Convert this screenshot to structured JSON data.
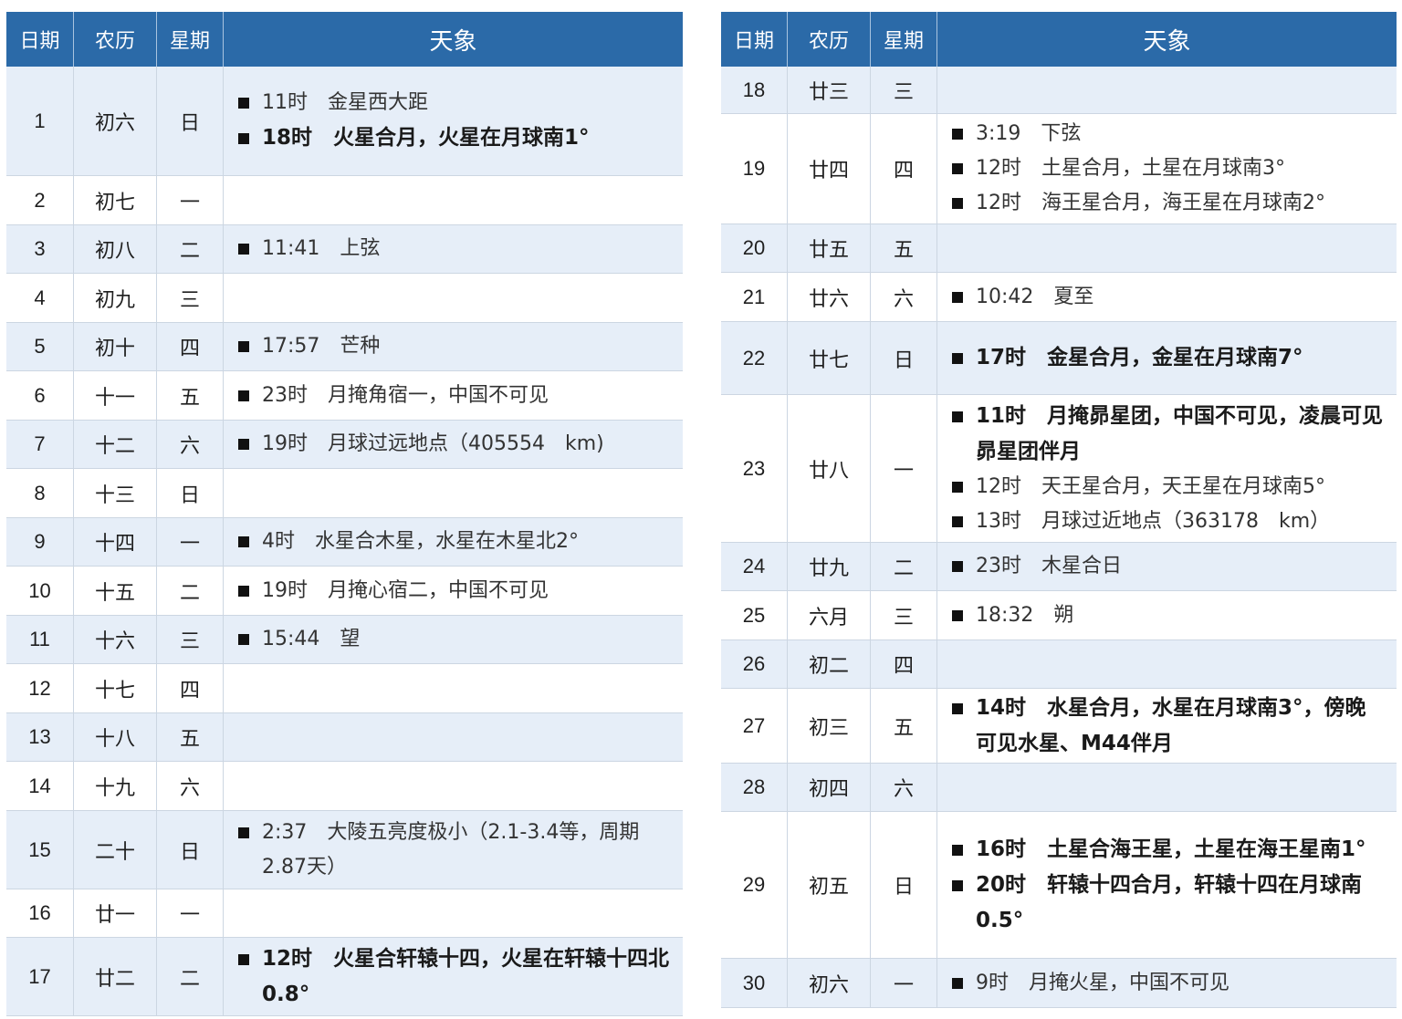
{
  "header": {
    "date": "日期",
    "lunar": "农历",
    "weekday": "星期",
    "events": "天象"
  },
  "left_rows": [
    {
      "date": "1",
      "lunar": "初六",
      "weekday": "日",
      "events": [
        {
          "text": "11时　金星西大距",
          "bold": false
        },
        {
          "text": "18时　火星合月，火星在月球南1°",
          "bold": true
        }
      ]
    },
    {
      "date": "2",
      "lunar": "初七",
      "weekday": "一",
      "events": []
    },
    {
      "date": "3",
      "lunar": "初八",
      "weekday": "二",
      "events": [
        {
          "text": "11:41　上弦",
          "bold": false
        }
      ]
    },
    {
      "date": "4",
      "lunar": "初九",
      "weekday": "三",
      "events": []
    },
    {
      "date": "5",
      "lunar": "初十",
      "weekday": "四",
      "events": [
        {
          "text": "17:57　芒种",
          "bold": false
        }
      ]
    },
    {
      "date": "6",
      "lunar": "十一",
      "weekday": "五",
      "events": [
        {
          "text": "23时　月掩角宿一，中国不可见",
          "bold": false
        }
      ]
    },
    {
      "date": "7",
      "lunar": "十二",
      "weekday": "六",
      "events": [
        {
          "text": "19时　月球过远地点（405554　km)",
          "bold": false
        }
      ]
    },
    {
      "date": "8",
      "lunar": "十三",
      "weekday": "日",
      "events": []
    },
    {
      "date": "9",
      "lunar": "十四",
      "weekday": "一",
      "events": [
        {
          "text": "4时　水星合木星，水星在木星北2°",
          "bold": false
        }
      ]
    },
    {
      "date": "10",
      "lunar": "十五",
      "weekday": "二",
      "events": [
        {
          "text": "19时　月掩心宿二，中国不可见",
          "bold": false
        }
      ]
    },
    {
      "date": "11",
      "lunar": "十六",
      "weekday": "三",
      "events": [
        {
          "text": "15:44　望",
          "bold": false
        }
      ]
    },
    {
      "date": "12",
      "lunar": "十七",
      "weekday": "四",
      "events": []
    },
    {
      "date": "13",
      "lunar": "十八",
      "weekday": "五",
      "events": []
    },
    {
      "date": "14",
      "lunar": "十九",
      "weekday": "六",
      "events": []
    },
    {
      "date": "15",
      "lunar": "二十",
      "weekday": "日",
      "events": [
        {
          "text": "2:37　大陵五亮度极小（2.1-3.4等，周期2.87天）",
          "bold": false
        }
      ]
    },
    {
      "date": "16",
      "lunar": "廿一",
      "weekday": "一",
      "events": []
    },
    {
      "date": "17",
      "lunar": "廿二",
      "weekday": "二",
      "events": [
        {
          "text": "12时　火星合轩辕十四，火星在轩辕十四北0.8°",
          "bold": true
        }
      ]
    }
  ],
  "right_rows": [
    {
      "date": "18",
      "lunar": "廿三",
      "weekday": "三",
      "events": []
    },
    {
      "date": "19",
      "lunar": "廿四",
      "weekday": "四",
      "events": [
        {
          "text": "3:19　下弦",
          "bold": false
        },
        {
          "text": "12时　土星合月，土星在月球南3°",
          "bold": false
        },
        {
          "text": "12时　海王星合月，海王星在月球南2°",
          "bold": false
        }
      ]
    },
    {
      "date": "20",
      "lunar": "廿五",
      "weekday": "五",
      "events": []
    },
    {
      "date": "21",
      "lunar": "廿六",
      "weekday": "六",
      "events": [
        {
          "text": "10:42　夏至",
          "bold": false
        }
      ]
    },
    {
      "date": "22",
      "lunar": "廿七",
      "weekday": "日",
      "events": [
        {
          "text": "17时　金星合月，金星在月球南7°",
          "bold": true
        }
      ]
    },
    {
      "date": "23",
      "lunar": "廿八",
      "weekday": "一",
      "events": [
        {
          "text": "11时　月掩昴星团，中国不可见，凌晨可见昴星团伴月",
          "bold": true
        },
        {
          "text": "12时　天王星合月，天王星在月球南5°",
          "bold": false
        },
        {
          "text": "13时　月球过近地点（363178　km）",
          "bold": false
        }
      ]
    },
    {
      "date": "24",
      "lunar": "廿九",
      "weekday": "二",
      "events": [
        {
          "text": "23时　木星合日",
          "bold": false
        }
      ]
    },
    {
      "date": "25",
      "lunar": "六月",
      "weekday": "三",
      "events": [
        {
          "text": "18:32　朔",
          "bold": false
        }
      ]
    },
    {
      "date": "26",
      "lunar": "初二",
      "weekday": "四",
      "events": []
    },
    {
      "date": "27",
      "lunar": "初三",
      "weekday": "五",
      "events": [
        {
          "text": "14时　水星合月，水星在月球南3°，傍晚可见水星、M44伴月",
          "bold": true
        }
      ]
    },
    {
      "date": "28",
      "lunar": "初四",
      "weekday": "六",
      "events": []
    },
    {
      "date": "29",
      "lunar": "初五",
      "weekday": "日",
      "events": [
        {
          "text": "16时　土星合海王星，土星在海王星南1°",
          "bold": true
        },
        {
          "text": "20时　轩辕十四合月，轩辕十四在月球南0.5°",
          "bold": true
        }
      ]
    },
    {
      "date": "30",
      "lunar": "初六",
      "weekday": "一",
      "events": [
        {
          "text": "9时　月掩火星，中国不可见",
          "bold": false
        }
      ]
    }
  ]
}
